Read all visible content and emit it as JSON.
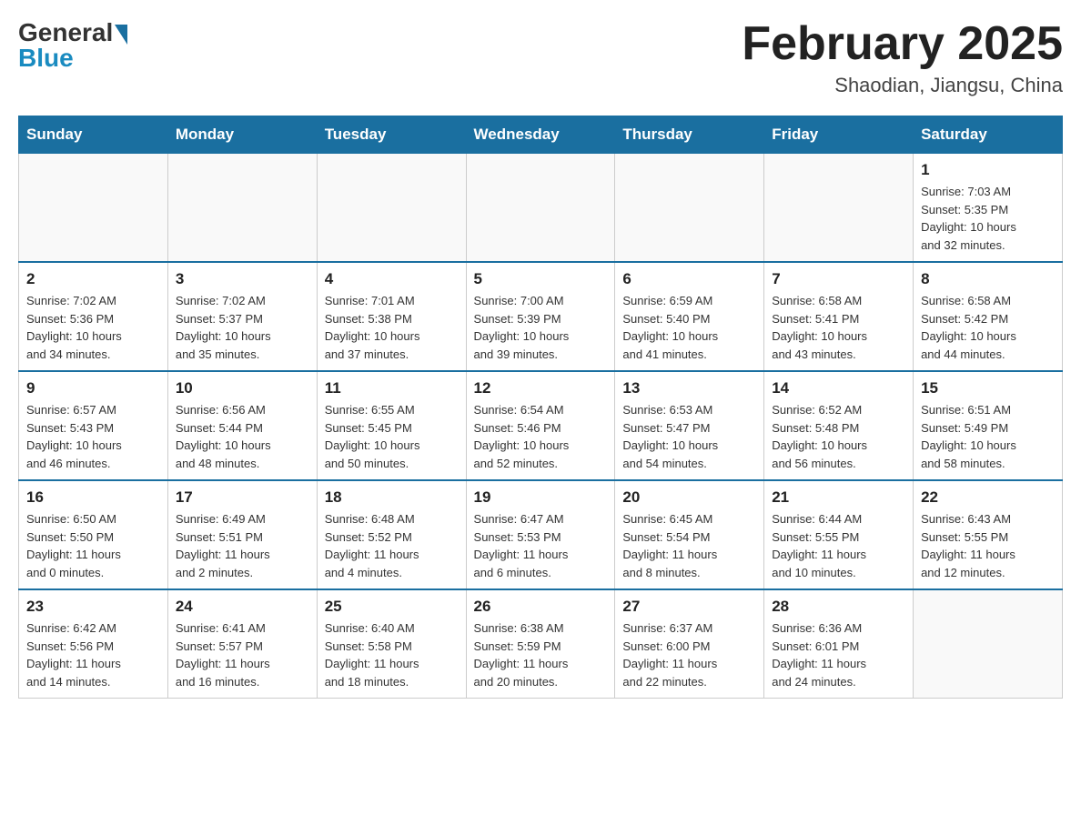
{
  "header": {
    "logo_general": "General",
    "logo_blue": "Blue",
    "month_title": "February 2025",
    "location": "Shaodian, Jiangsu, China"
  },
  "days_of_week": [
    "Sunday",
    "Monday",
    "Tuesday",
    "Wednesday",
    "Thursday",
    "Friday",
    "Saturday"
  ],
  "weeks": [
    [
      {
        "day": "",
        "info": ""
      },
      {
        "day": "",
        "info": ""
      },
      {
        "day": "",
        "info": ""
      },
      {
        "day": "",
        "info": ""
      },
      {
        "day": "",
        "info": ""
      },
      {
        "day": "",
        "info": ""
      },
      {
        "day": "1",
        "info": "Sunrise: 7:03 AM\nSunset: 5:35 PM\nDaylight: 10 hours\nand 32 minutes."
      }
    ],
    [
      {
        "day": "2",
        "info": "Sunrise: 7:02 AM\nSunset: 5:36 PM\nDaylight: 10 hours\nand 34 minutes."
      },
      {
        "day": "3",
        "info": "Sunrise: 7:02 AM\nSunset: 5:37 PM\nDaylight: 10 hours\nand 35 minutes."
      },
      {
        "day": "4",
        "info": "Sunrise: 7:01 AM\nSunset: 5:38 PM\nDaylight: 10 hours\nand 37 minutes."
      },
      {
        "day": "5",
        "info": "Sunrise: 7:00 AM\nSunset: 5:39 PM\nDaylight: 10 hours\nand 39 minutes."
      },
      {
        "day": "6",
        "info": "Sunrise: 6:59 AM\nSunset: 5:40 PM\nDaylight: 10 hours\nand 41 minutes."
      },
      {
        "day": "7",
        "info": "Sunrise: 6:58 AM\nSunset: 5:41 PM\nDaylight: 10 hours\nand 43 minutes."
      },
      {
        "day": "8",
        "info": "Sunrise: 6:58 AM\nSunset: 5:42 PM\nDaylight: 10 hours\nand 44 minutes."
      }
    ],
    [
      {
        "day": "9",
        "info": "Sunrise: 6:57 AM\nSunset: 5:43 PM\nDaylight: 10 hours\nand 46 minutes."
      },
      {
        "day": "10",
        "info": "Sunrise: 6:56 AM\nSunset: 5:44 PM\nDaylight: 10 hours\nand 48 minutes."
      },
      {
        "day": "11",
        "info": "Sunrise: 6:55 AM\nSunset: 5:45 PM\nDaylight: 10 hours\nand 50 minutes."
      },
      {
        "day": "12",
        "info": "Sunrise: 6:54 AM\nSunset: 5:46 PM\nDaylight: 10 hours\nand 52 minutes."
      },
      {
        "day": "13",
        "info": "Sunrise: 6:53 AM\nSunset: 5:47 PM\nDaylight: 10 hours\nand 54 minutes."
      },
      {
        "day": "14",
        "info": "Sunrise: 6:52 AM\nSunset: 5:48 PM\nDaylight: 10 hours\nand 56 minutes."
      },
      {
        "day": "15",
        "info": "Sunrise: 6:51 AM\nSunset: 5:49 PM\nDaylight: 10 hours\nand 58 minutes."
      }
    ],
    [
      {
        "day": "16",
        "info": "Sunrise: 6:50 AM\nSunset: 5:50 PM\nDaylight: 11 hours\nand 0 minutes."
      },
      {
        "day": "17",
        "info": "Sunrise: 6:49 AM\nSunset: 5:51 PM\nDaylight: 11 hours\nand 2 minutes."
      },
      {
        "day": "18",
        "info": "Sunrise: 6:48 AM\nSunset: 5:52 PM\nDaylight: 11 hours\nand 4 minutes."
      },
      {
        "day": "19",
        "info": "Sunrise: 6:47 AM\nSunset: 5:53 PM\nDaylight: 11 hours\nand 6 minutes."
      },
      {
        "day": "20",
        "info": "Sunrise: 6:45 AM\nSunset: 5:54 PM\nDaylight: 11 hours\nand 8 minutes."
      },
      {
        "day": "21",
        "info": "Sunrise: 6:44 AM\nSunset: 5:55 PM\nDaylight: 11 hours\nand 10 minutes."
      },
      {
        "day": "22",
        "info": "Sunrise: 6:43 AM\nSunset: 5:55 PM\nDaylight: 11 hours\nand 12 minutes."
      }
    ],
    [
      {
        "day": "23",
        "info": "Sunrise: 6:42 AM\nSunset: 5:56 PM\nDaylight: 11 hours\nand 14 minutes."
      },
      {
        "day": "24",
        "info": "Sunrise: 6:41 AM\nSunset: 5:57 PM\nDaylight: 11 hours\nand 16 minutes."
      },
      {
        "day": "25",
        "info": "Sunrise: 6:40 AM\nSunset: 5:58 PM\nDaylight: 11 hours\nand 18 minutes."
      },
      {
        "day": "26",
        "info": "Sunrise: 6:38 AM\nSunset: 5:59 PM\nDaylight: 11 hours\nand 20 minutes."
      },
      {
        "day": "27",
        "info": "Sunrise: 6:37 AM\nSunset: 6:00 PM\nDaylight: 11 hours\nand 22 minutes."
      },
      {
        "day": "28",
        "info": "Sunrise: 6:36 AM\nSunset: 6:01 PM\nDaylight: 11 hours\nand 24 minutes."
      },
      {
        "day": "",
        "info": ""
      }
    ]
  ]
}
